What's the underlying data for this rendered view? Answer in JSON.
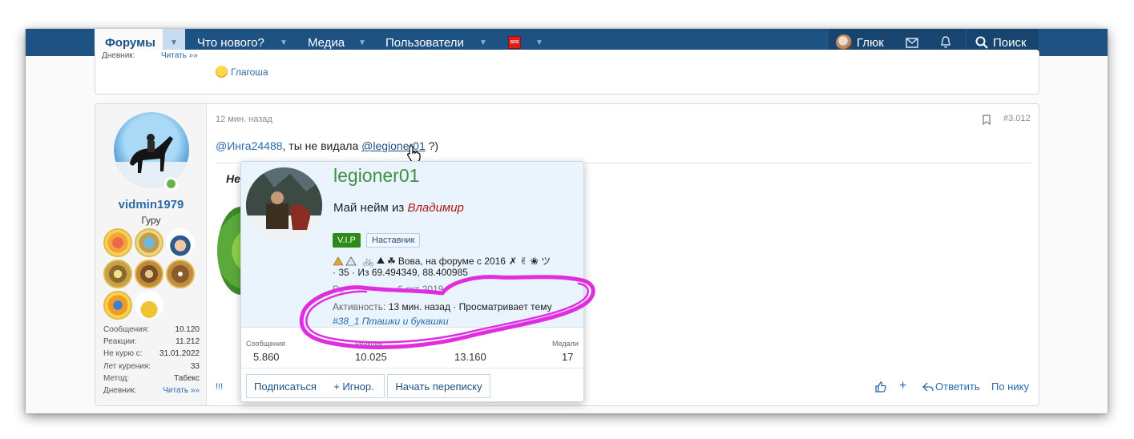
{
  "nav": {
    "forums": "Форумы",
    "whats_new": "Что нового?",
    "media": "Медиа",
    "members": "Пользователи",
    "sos": "SOS",
    "user": "Глюк",
    "search": "Поиск"
  },
  "prev_post": {
    "diary_label": "Дневник:",
    "diary_link": "Читать »»",
    "reaction_user": "Глагоша"
  },
  "post": {
    "time": "12 мин. назад",
    "bookmark_icon": "bookmark-icon",
    "number": "#3.012",
    "mention1": "@Инга24488",
    "text_mid": ", ты не видала ",
    "mention2": "@legioner01",
    "text_end": " ?)",
    "partial_text": "Не",
    "footer_mark": "!!!",
    "reply": "Ответить",
    "by_nick": "По нику",
    "plus": "+"
  },
  "author": {
    "name": "vidmin1979",
    "title": "Гуру",
    "stats": [
      {
        "label": "Сообщения:",
        "value": "10.120"
      },
      {
        "label": "Реакции:",
        "value": "11.212"
      },
      {
        "label": "Не курю с:",
        "value": "31.01.2022"
      },
      {
        "label": "Лет курения:",
        "value": "33"
      },
      {
        "label": "Метод:",
        "value": "Табекс"
      },
      {
        "label": "Дневник:",
        "value": "Читать »»"
      }
    ]
  },
  "popup": {
    "username": "legioner01",
    "tagline_prefix": "Май нейм из ",
    "tagline_city": "Владимир",
    "badge_vip": "V.I.P",
    "badge_role": "Наставник",
    "info_line1": "Вова, на форуме с 2016",
    "info_line2": "· 35 · Из 69.494349, 88.400985",
    "registered_partial": "Ре                    6 окт 2019",
    "activity_label": "Активность:",
    "activity_value": "13 мин. назад · Просматривает тему",
    "activity_thread": "#38_1 Пташки и букашки",
    "stats": [
      {
        "label": "Сообщения",
        "value": "5.860"
      },
      {
        "label": "Реакции",
        "value": "10.025"
      },
      {
        "label": "",
        "value": "13.160"
      },
      {
        "label": "Медали",
        "value": "17"
      }
    ],
    "buttons": {
      "follow": "Подписаться",
      "ignore": "+ Игнор.",
      "message": "Начать переписку"
    }
  },
  "colors": {
    "navbar": "#1e5283",
    "link": "#2a6aa8",
    "username_green": "#3f8f46",
    "city_red": "#b01515",
    "vip_green": "#2c8a17",
    "highlight_magenta": "#e12de0"
  }
}
